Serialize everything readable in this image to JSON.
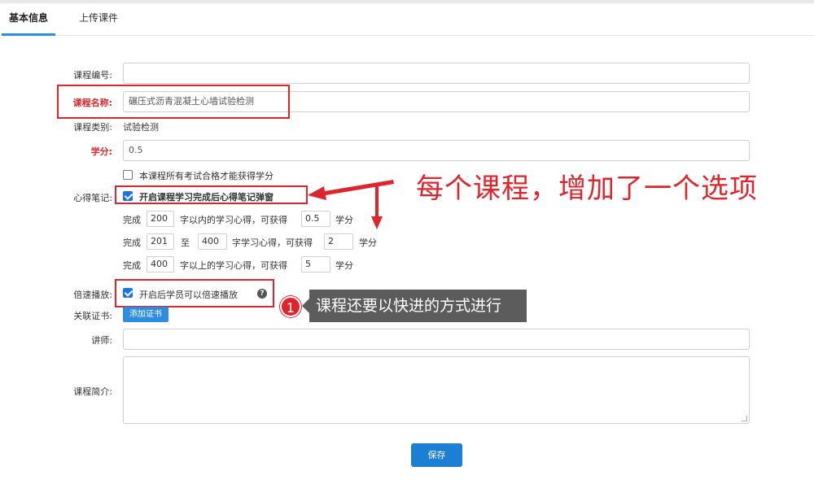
{
  "tabs": [
    {
      "label": "基本信息"
    },
    {
      "label": "上传课件"
    }
  ],
  "form": {
    "course_no": {
      "label": "课程编号:",
      "value": ""
    },
    "course_name": {
      "label": "课程名称:",
      "value": "碾压式沥青混凝土心墙试验检测"
    },
    "course_type": {
      "label": "课程类别:",
      "value": "试验检测"
    },
    "credit": {
      "label": "学分:",
      "value": "0.5"
    },
    "all_pass_checkbox": {
      "label": "本课程所有考试合格才能获得学分",
      "checked": false
    },
    "notes": {
      "label": "心得笔记:",
      "popup_checkbox": {
        "label": "开启课程学习完成后心得笔记弹窗",
        "checked": true
      },
      "rows": [
        {
          "prefix": "完成",
          "a": "200",
          "mid": "字以内的学习心得，可获得",
          "score": "0.5",
          "unit": "学分"
        },
        {
          "prefix": "完成",
          "a": "201",
          "to": "至",
          "b": "400",
          "mid": "字学习心得，可获得",
          "score": "2",
          "unit": "学分"
        },
        {
          "prefix": "完成",
          "a": "400",
          "mid": "字以上的学习心得，可获得",
          "score": "5",
          "unit": "学分"
        }
      ]
    },
    "speed": {
      "label": "倍速播放:",
      "checkbox": {
        "label": "开启后学员可以倍速播放",
        "checked": true
      },
      "help_icon": "question-circle-icon"
    },
    "cert": {
      "label": "关联证书:",
      "button": "添加证书"
    },
    "teacher": {
      "label": "讲师:",
      "value": ""
    },
    "intro": {
      "label": "课程简介:",
      "value": ""
    }
  },
  "save_button": "保存",
  "annotations": {
    "big_text": "每个课程，增加了一个选项",
    "badge_number": "1",
    "tooltip_text": "课程还要以快进的方式进行",
    "accent_color": "#e0242b"
  }
}
